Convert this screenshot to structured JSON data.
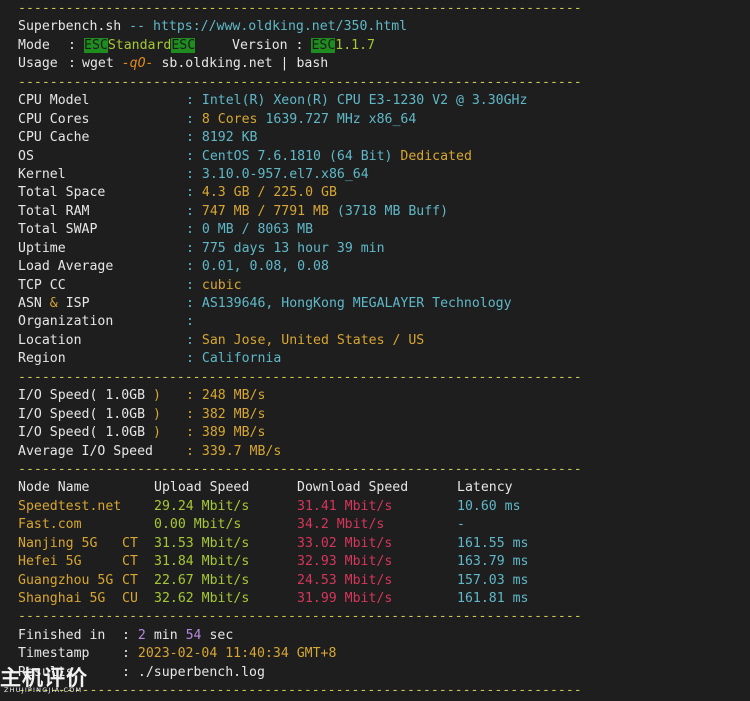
{
  "separator": "-----------------------------------------------------------------------",
  "header": {
    "title": "Superbench.sh",
    "title_sep": "--",
    "url": "https://www.oldking.net/350.html",
    "mode_label": "Mode",
    "colon": ":",
    "esc": "ESC",
    "mode_value": "Standard",
    "version_label": "Version",
    "version_value": "1.1.7",
    "usage_label": "Usage",
    "usage_cmd_1": "wget",
    "usage_flag": "-qO-",
    "usage_cmd_2": "sb.oldking.net",
    "usage_pipe": "|",
    "usage_cmd_3": "bash"
  },
  "system": [
    {
      "label": "CPU Model",
      "value": "Intel(R) Xeon(R) CPU E3-1230 V2 @ 3.30GHz"
    },
    {
      "label": "CPU Cores",
      "value_y": "8 Cores",
      "value": "1639.727 MHz x86_64"
    },
    {
      "label": "CPU Cache",
      "value": "8192 KB"
    },
    {
      "label": "OS",
      "value": "CentOS 7.6.1810 (64 Bit)",
      "value_y": "Dedicated"
    },
    {
      "label": "Kernel",
      "value": "3.10.0-957.el7.x86_64"
    },
    {
      "label": "Total Space",
      "value_y": "4.3 GB / 225.0 GB"
    },
    {
      "label": "Total RAM",
      "value_y": "747 MB / 7791 MB",
      "value": "(3718 MB Buff)"
    },
    {
      "label": "Total SWAP",
      "value": "0 MB / 8063 MB"
    },
    {
      "label": "Uptime",
      "value": "775 days 13 hour 39 min"
    },
    {
      "label": "Load Average",
      "value": "0.01, 0.08, 0.08"
    },
    {
      "label": "TCP CC",
      "value_y": "cubic"
    },
    {
      "label_a": "ASN",
      "label_amp": "&",
      "label_b": "ISP",
      "value": "AS139646, HongKong MEGALAYER Technology"
    },
    {
      "label": "Organization",
      "value": ""
    },
    {
      "label": "Location",
      "value_y": "San Jose, United States / US"
    },
    {
      "label": "Region",
      "value": "California"
    }
  ],
  "io": [
    {
      "label": "I/O Speed(",
      "size": "1.0GB",
      "close": ")",
      "value": "248 MB/s"
    },
    {
      "label": "I/O Speed(",
      "size": "1.0GB",
      "close": ")",
      "value": "382 MB/s"
    },
    {
      "label": "I/O Speed(",
      "size": "1.0GB",
      "close": ")",
      "value": "389 MB/s"
    },
    {
      "label": "Average I/O Speed",
      "value": "339.7 MB/s"
    }
  ],
  "speedtest": {
    "headers": {
      "node": "Node Name",
      "upload": "Upload Speed",
      "download": "Download Speed",
      "latency": "Latency"
    },
    "rows": [
      {
        "node": "Speedtest.net",
        "isp": "",
        "upload": "29.24 Mbit/s",
        "download": "31.41 Mbit/s",
        "latency": "10.60 ms"
      },
      {
        "node": "Fast.com",
        "isp": "",
        "upload": "0.00 Mbit/s",
        "download": "34.2 Mbit/s",
        "latency": "-"
      },
      {
        "node": "Nanjing 5G",
        "isp": "CT",
        "upload": "31.53 Mbit/s",
        "download": "33.02 Mbit/s",
        "latency": "161.55 ms"
      },
      {
        "node": "Hefei 5G",
        "isp": "CT",
        "upload": "31.84 Mbit/s",
        "download": "32.93 Mbit/s",
        "latency": "163.79 ms"
      },
      {
        "node": "Guangzhou 5G",
        "isp": "CT",
        "upload": "22.67 Mbit/s",
        "download": "24.53 Mbit/s",
        "latency": "157.03 ms"
      },
      {
        "node": "Shanghai 5G",
        "isp": "CU",
        "upload": "32.62 Mbit/s",
        "download": "31.99 Mbit/s",
        "latency": "161.81 ms"
      }
    ]
  },
  "footer": {
    "finished_label": "Finished in",
    "min_num": "2",
    "min_unit": "min",
    "sec_num": "54",
    "sec_unit": "sec",
    "timestamp_label": "Timestamp",
    "timestamp_value": "2023-02-04 11:40:34",
    "tz": "GMT+8",
    "results_label": "Results",
    "results_value": "./superbench.log"
  },
  "watermark": {
    "big": "主机评价",
    "small": "ZHUJIPINGJIA.COM"
  },
  "colors": {
    "background": "#1e1e1e",
    "separator": "#c9c94a",
    "cyan": "#5fb8c8",
    "yellow": "#d7a632",
    "green": "#a6c832",
    "red": "#d6365a",
    "purple": "#b48ae0",
    "esc_bg": "#1e8c1e"
  }
}
